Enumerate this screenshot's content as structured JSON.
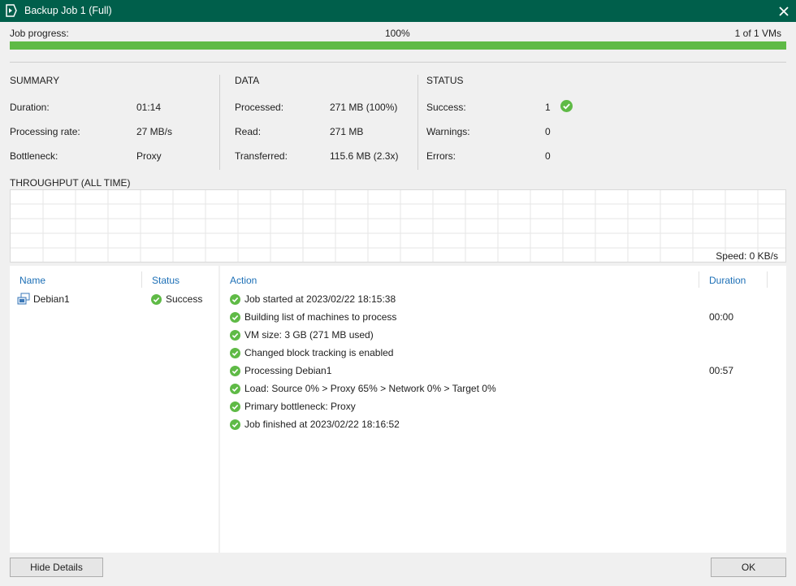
{
  "window": {
    "title": "Backup Job 1 (Full)"
  },
  "progress": {
    "label": "Job progress:",
    "percent_text": "100%",
    "percent": 100,
    "vms": "1 of 1 VMs",
    "color": "#5fba46"
  },
  "summary": {
    "title": "SUMMARY",
    "rows": [
      {
        "label": "Duration:",
        "value": "01:14"
      },
      {
        "label": "Processing rate:",
        "value": "27 MB/s"
      },
      {
        "label": "Bottleneck:",
        "value": "Proxy"
      }
    ]
  },
  "data_section": {
    "title": "DATA",
    "rows": [
      {
        "label": "Processed:",
        "value": "271 MB (100%)"
      },
      {
        "label": "Read:",
        "value": "271 MB"
      },
      {
        "label": "Transferred:",
        "value": "115.6 MB (2.3x)"
      }
    ]
  },
  "status_section": {
    "title": "STATUS",
    "rows": [
      {
        "label": "Success:",
        "value": "1"
      },
      {
        "label": "Warnings:",
        "value": "0"
      },
      {
        "label": "Errors:",
        "value": "0"
      }
    ]
  },
  "throughput": {
    "title": "THROUGHPUT (ALL TIME)",
    "speed": "Speed: 0 KB/s"
  },
  "vm_list": {
    "headers": {
      "name": "Name",
      "status": "Status"
    },
    "items": [
      {
        "name": "Debian1",
        "status": "Success",
        "icon": "vm-icon"
      }
    ]
  },
  "actions": {
    "headers": {
      "action": "Action",
      "duration": "Duration"
    },
    "items": [
      {
        "text": "Job started at 2023/02/22 18:15:38",
        "duration": ""
      },
      {
        "text": "Building list of machines to process",
        "duration": "00:00"
      },
      {
        "text": "VM size: 3 GB (271 MB used)",
        "duration": ""
      },
      {
        "text": "Changed block tracking is enabled",
        "duration": ""
      },
      {
        "text": "Processing Debian1",
        "duration": "00:57"
      },
      {
        "text": "Load: Source 0% > Proxy 65% > Network 0% > Target 0%",
        "duration": ""
      },
      {
        "text": "Primary bottleneck: Proxy",
        "duration": ""
      },
      {
        "text": "Job finished at 2023/02/22 18:16:52",
        "duration": ""
      }
    ]
  },
  "buttons": {
    "hide_details": "Hide Details",
    "ok": "OK"
  },
  "colors": {
    "titlebar": "#005f4b",
    "accent_link": "#1c6fb6",
    "success": "#5fba46"
  }
}
